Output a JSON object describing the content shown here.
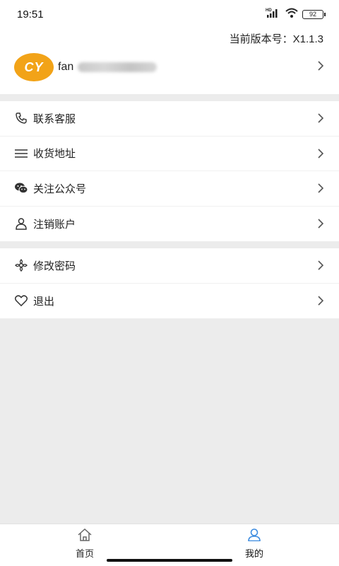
{
  "status_bar": {
    "time": "19:51",
    "network_label": "HD",
    "battery": "92"
  },
  "profile": {
    "version_text": "当前版本号：X1.1.3",
    "avatar_text": "CY",
    "avatar_color": "#f2a318",
    "username": "fan"
  },
  "menu_group_1": [
    {
      "label": "联系客服",
      "icon": "phone-icon"
    },
    {
      "label": "收货地址",
      "icon": "list-icon"
    },
    {
      "label": "关注公众号",
      "icon": "wechat-icon"
    },
    {
      "label": "注销账户",
      "icon": "user-icon"
    }
  ],
  "menu_group_2": [
    {
      "label": "修改密码",
      "icon": "flower-icon"
    },
    {
      "label": "退出",
      "icon": "heart-icon"
    }
  ],
  "tabbar": {
    "home_label": "首页",
    "mine_label": "我的",
    "active_color": "#3d8ce0"
  }
}
